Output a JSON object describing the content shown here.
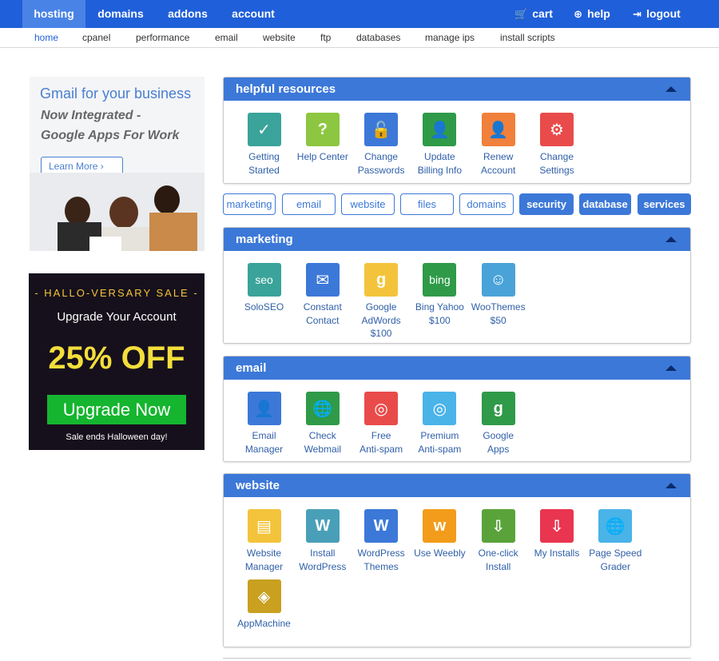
{
  "topnav": {
    "hosting": "hosting",
    "domains": "domains",
    "addons": "addons",
    "account": "account",
    "cart": "cart",
    "help": "help",
    "logout": "logout"
  },
  "subnav": [
    "home",
    "cpanel",
    "performance",
    "email",
    "website",
    "ftp",
    "databases",
    "manage ips",
    "install scripts"
  ],
  "ads": {
    "gmail": {
      "line1": "Gmail for your business",
      "line2": "Now Integrated -",
      "line3": "Google Apps For Work",
      "button": "Learn More ›"
    },
    "sale": {
      "line1": "- HALLO-VERSARY SALE -",
      "line2": "Upgrade Your Account",
      "line3": "25% OFF",
      "button": "Upgrade Now",
      "line4": "Sale ends Halloween day!"
    }
  },
  "panels": {
    "helpful": {
      "title": "helpful resources",
      "items": [
        {
          "l1": "Getting",
          "l2": "Started",
          "color": "#3aa39a",
          "glyph": "✓"
        },
        {
          "l1": "Help Center",
          "l2": "",
          "color": "#8dc641",
          "glyph": "?"
        },
        {
          "l1": "Change",
          "l2": "Passwords",
          "color": "#3c78d8",
          "glyph": "🔓"
        },
        {
          "l1": "Update",
          "l2": "Billing Info",
          "color": "#2f9a48",
          "glyph": "👤"
        },
        {
          "l1": "Renew",
          "l2": "Account",
          "color": "#f0803c",
          "glyph": "👤"
        },
        {
          "l1": "Change",
          "l2": "Settings",
          "color": "#e94b4b",
          "glyph": "⚙"
        }
      ]
    },
    "filters": [
      "marketing",
      "email",
      "website",
      "files",
      "domains",
      "security",
      "database",
      "services"
    ],
    "marketing": {
      "title": "marketing",
      "items": [
        {
          "l1": "SoloSEO",
          "l2": "",
          "l3": "",
          "color": "#3aa39a",
          "glyph": "seo"
        },
        {
          "l1": "Constant",
          "l2": "Contact",
          "l3": "",
          "color": "#3c78d8",
          "glyph": "✉"
        },
        {
          "l1": "Google",
          "l2": "AdWords",
          "l3": "$100",
          "color": "#f3c43b",
          "glyph": "g"
        },
        {
          "l1": "Bing Yahoo",
          "l2": "$100",
          "l3": "",
          "color": "#2f9a48",
          "glyph": "bing"
        },
        {
          "l1": "WooThemes",
          "l2": "$50",
          "l3": "",
          "color": "#4aa3d8",
          "glyph": "☺"
        }
      ]
    },
    "email": {
      "title": "email",
      "items": [
        {
          "l1": "Email",
          "l2": "Manager",
          "color": "#3c78d8",
          "glyph": "👤"
        },
        {
          "l1": "Check",
          "l2": "Webmail",
          "color": "#2f9a48",
          "glyph": "🌐"
        },
        {
          "l1": "Free",
          "l2": "Anti-spam",
          "color": "#e94b4b",
          "glyph": "◎"
        },
        {
          "l1": "Premium",
          "l2": "Anti-spam",
          "color": "#4ab3e8",
          "glyph": "◎"
        },
        {
          "l1": "Google",
          "l2": "Apps",
          "color": "#2f9a48",
          "glyph": "g"
        }
      ]
    },
    "website": {
      "title": "website",
      "items": [
        {
          "l1": "Website",
          "l2": "Manager",
          "color": "#f3c43b",
          "glyph": "▤"
        },
        {
          "l1": "Install",
          "l2": "WordPress",
          "color": "#4a9fb8",
          "glyph": "W"
        },
        {
          "l1": "WordPress",
          "l2": "Themes",
          "color": "#3c78d8",
          "glyph": "W"
        },
        {
          "l1": "Use Weebly",
          "l2": "",
          "color": "#f39c1b",
          "glyph": "w"
        },
        {
          "l1": "One-click",
          "l2": "Install",
          "color": "#5aa33a",
          "glyph": "⇩"
        },
        {
          "l1": "My Installs",
          "l2": "",
          "color": "#e9354f",
          "glyph": "⇩"
        },
        {
          "l1": "Page Speed",
          "l2": "Grader",
          "color": "#4ab3e8",
          "glyph": "🌐"
        },
        {
          "l1": "AppMachine",
          "l2": "",
          "color": "#c9a020",
          "glyph": "◈"
        }
      ]
    }
  }
}
